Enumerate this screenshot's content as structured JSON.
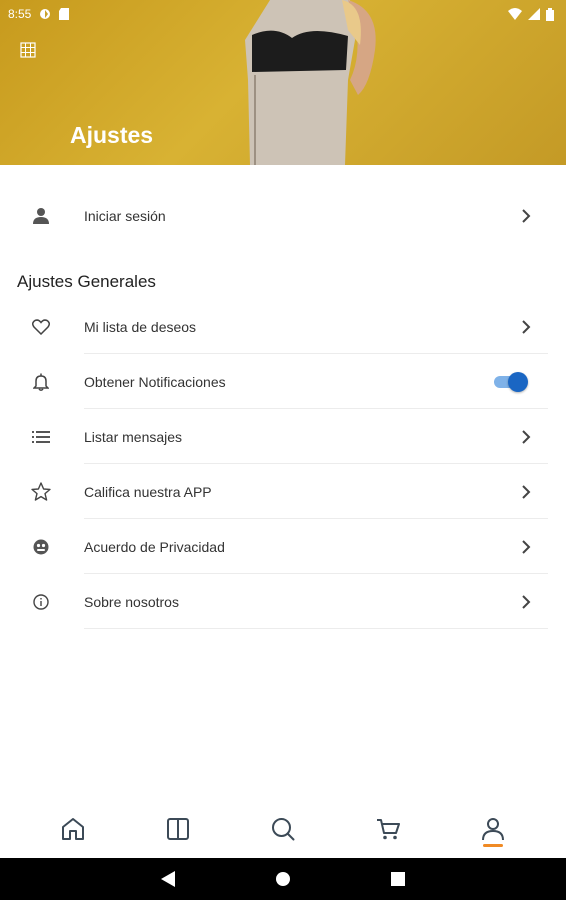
{
  "status_bar": {
    "time": "8:55"
  },
  "header": {
    "title": "Ajustes"
  },
  "login": {
    "label": "Iniciar sesión"
  },
  "general": {
    "title": "Ajustes Generales",
    "items": [
      {
        "label": "Mi lista de deseos",
        "icon": "heart-icon"
      },
      {
        "label": "Obtener Notificaciones",
        "icon": "bell-icon",
        "toggle": true
      },
      {
        "label": "Listar mensajes",
        "icon": "list-icon"
      },
      {
        "label": "Califica nuestra APP",
        "icon": "star-icon"
      },
      {
        "label": "Acuerdo de Privacidad",
        "icon": "privacy-icon"
      },
      {
        "label": "Sobre nosotros",
        "icon": "info-icon"
      }
    ]
  },
  "notifications_enabled": true,
  "bottom_nav": [
    "home-icon",
    "catalog-icon",
    "search-icon",
    "cart-icon",
    "account-icon"
  ],
  "colors": {
    "accent": "#1a66c3",
    "active_tab": "#f08a24",
    "header": "#d3aa2d"
  }
}
